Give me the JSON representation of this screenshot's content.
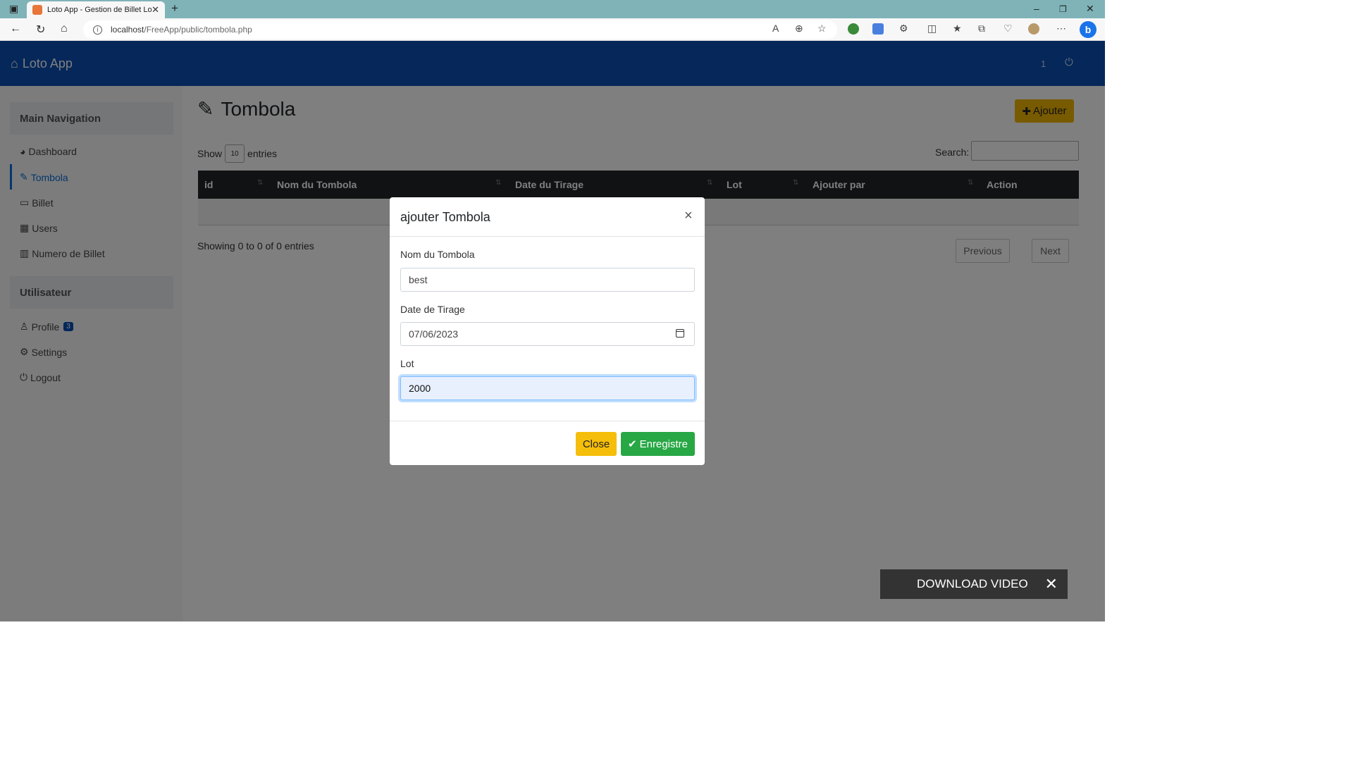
{
  "browser": {
    "tab_title": "Loto App - Gestion de Billet Loto",
    "url_host": "localhost",
    "url_path": "/FreeApp/public/tombola.php"
  },
  "header": {
    "brand": "Loto App",
    "count": "1"
  },
  "sidebar": {
    "main_nav_title": "Main Navigation",
    "items": [
      {
        "label": "Dashboard"
      },
      {
        "label": "Tombola"
      },
      {
        "label": "Billet"
      },
      {
        "label": "Users"
      },
      {
        "label": "Numero de Billet"
      }
    ],
    "user_section_title": "Utilisateur",
    "user_items": [
      {
        "label": "Profile",
        "badge": "3"
      },
      {
        "label": "Settings"
      },
      {
        "label": "Logout"
      }
    ]
  },
  "main": {
    "title": "Tombola",
    "add_button": "Ajouter",
    "show_label": "Show",
    "show_value": "10",
    "entries_label": "entries",
    "search_label": "Search:",
    "columns": [
      "id",
      "Nom du Tombola",
      "Date du Tirage",
      "Lot",
      "Ajouter par",
      "Action"
    ],
    "info": "Showing 0 to 0 of 0 entries",
    "previous": "Previous",
    "next": "Next"
  },
  "modal": {
    "title": "ajouter Tombola",
    "close_x": "×",
    "fields": [
      {
        "label": "Nom du Tombola",
        "value": "best"
      },
      {
        "label": "Date de Tirage",
        "value": "07/06/2023"
      },
      {
        "label": "Lot",
        "value": "2000"
      }
    ],
    "close_button": "Close",
    "save_button": "Enregistre"
  },
  "download_bar": {
    "label": "DOWNLOAD VIDEO"
  },
  "colors": {
    "header_blue": "#0b4fb5",
    "accent_yellow": "#f0b400",
    "success_green": "#28a745"
  }
}
